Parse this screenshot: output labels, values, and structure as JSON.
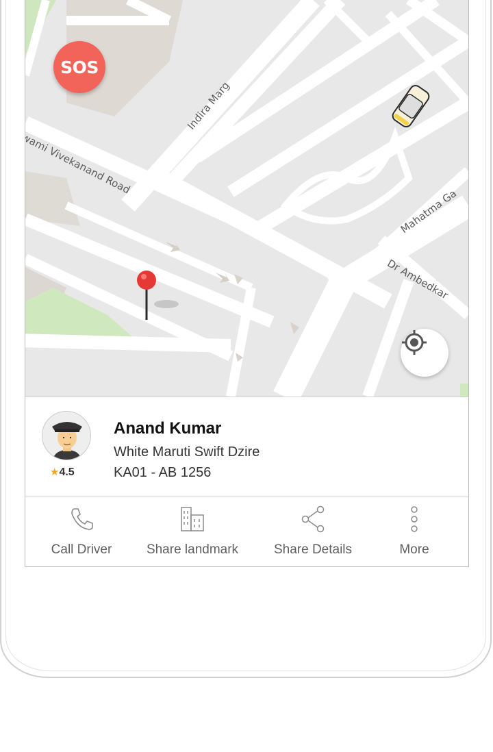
{
  "map": {
    "road_labels": {
      "indira": "Indira Marg",
      "vivekanand": "wami Vivekanand Road",
      "mahatma": "Mahatma Ga",
      "ambedkar": "Dr Ambedkar"
    },
    "sos_label": "SOS"
  },
  "driver": {
    "name": "Anand Kumar",
    "car_model": "White Maruti Swift Dzire",
    "plate": "KA01 - AB 1256",
    "rating": "4.5",
    "rating_icon": "star-icon"
  },
  "actions": [
    {
      "label": "Call Driver",
      "icon": "phone-icon"
    },
    {
      "label": "Share landmark",
      "icon": "building-icon"
    },
    {
      "label": "Share Details",
      "icon": "share-icon"
    },
    {
      "label": "More",
      "icon": "more-vertical-icon"
    }
  ],
  "colors": {
    "sos": "#f2645a",
    "star": "#f5a623",
    "pin": "#e53935"
  }
}
